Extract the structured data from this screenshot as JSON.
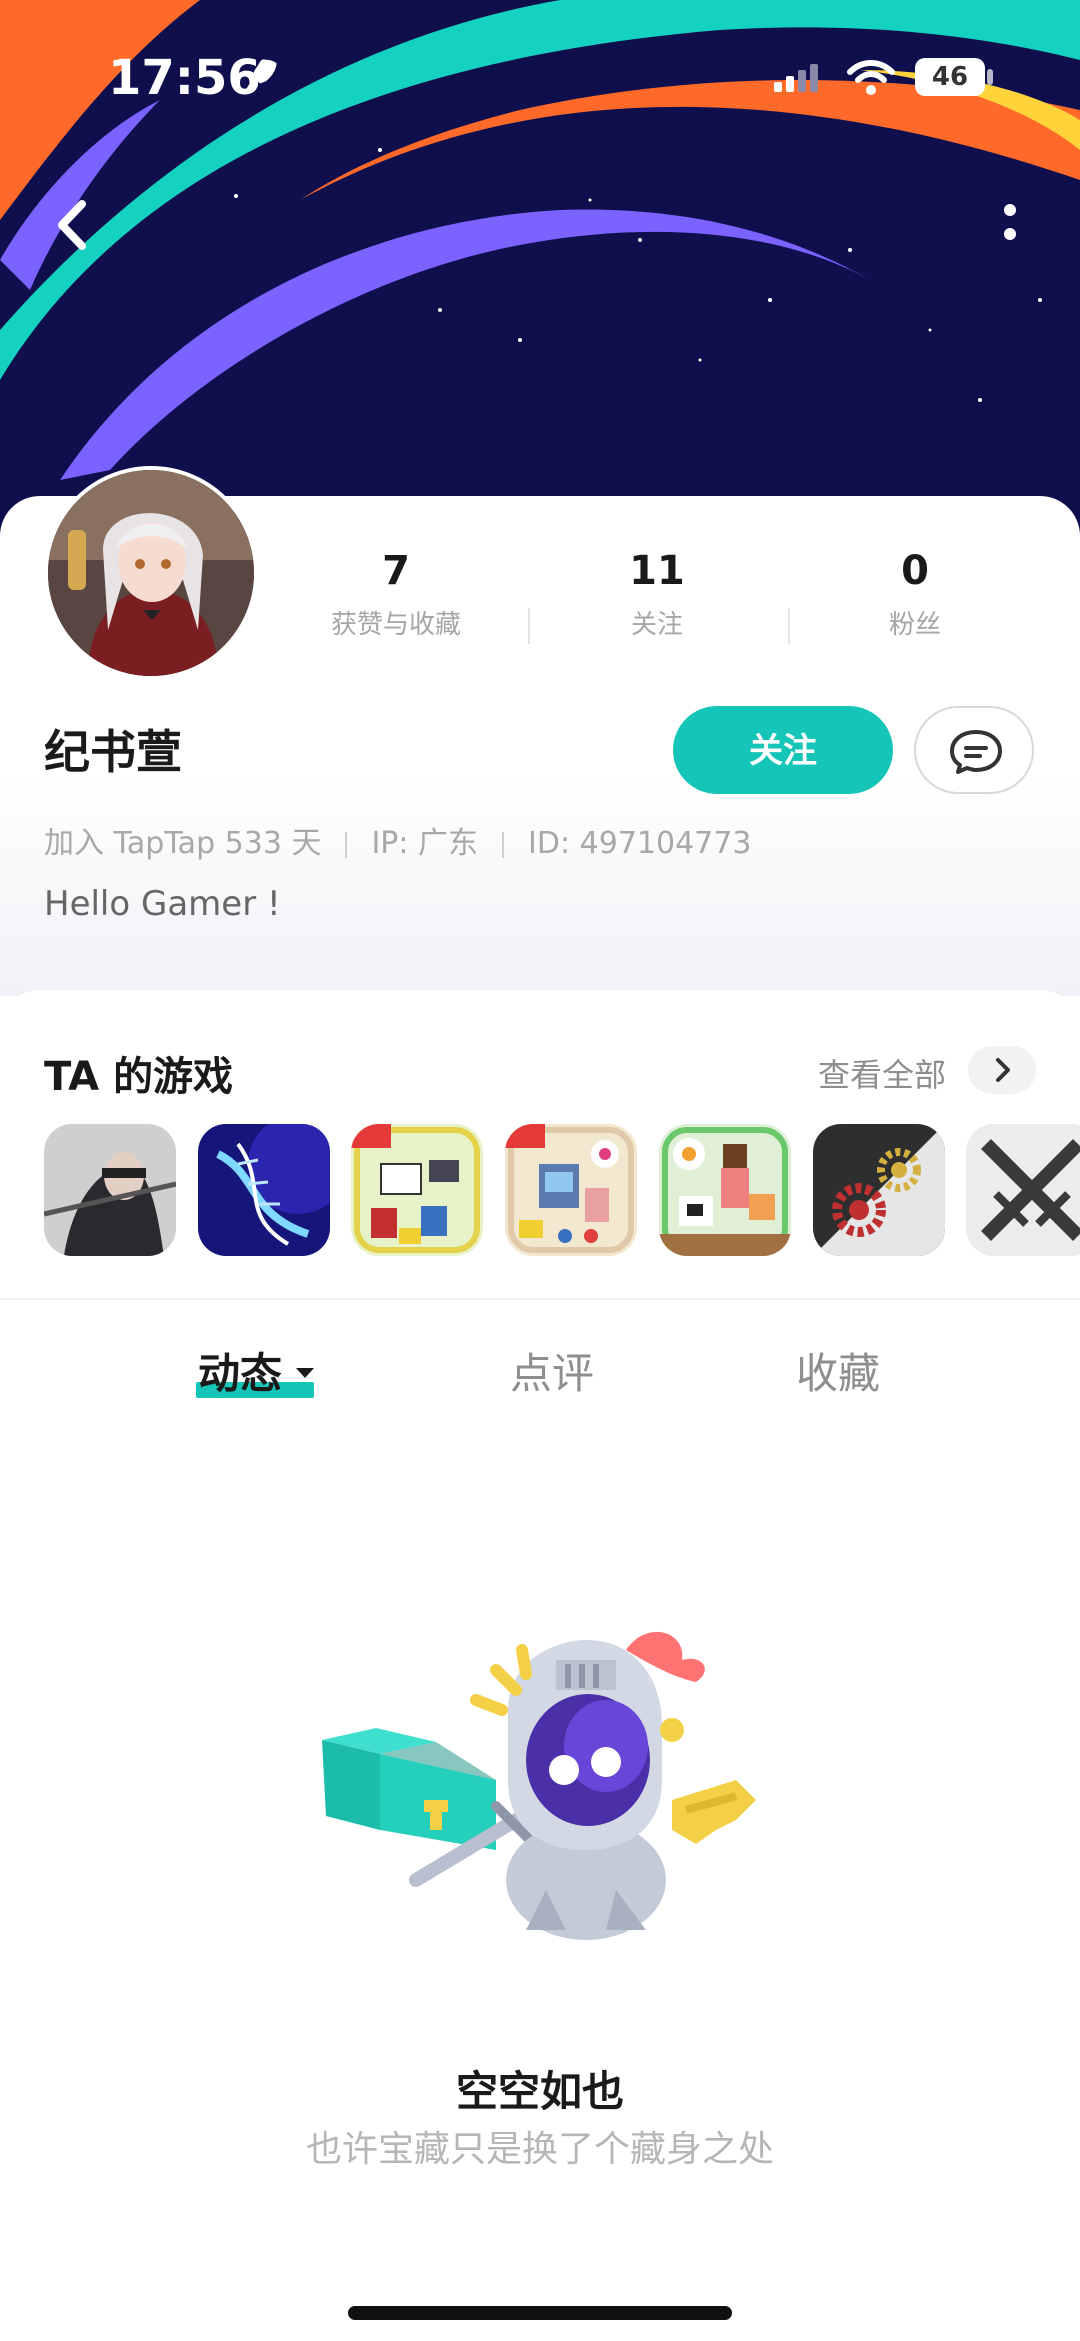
{
  "status_bar": {
    "time": "17:56",
    "battery": "46"
  },
  "header": {
    "back_icon": "chevron-left-icon",
    "more_icon": "more-vertical-icon"
  },
  "stats": [
    {
      "value": "7",
      "label": "获赞与收藏"
    },
    {
      "value": "11",
      "label": "关注"
    },
    {
      "value": "0",
      "label": "粉丝"
    }
  ],
  "profile": {
    "name": "纪书萱",
    "follow_label": "关注",
    "meta": [
      "加入 TapTap 533 天",
      "IP: 广东",
      "ID: 497104773"
    ],
    "bio": "Hello Gamer !"
  },
  "games": {
    "title": "TA 的游戏",
    "see_all": "查看全部",
    "items": [
      "game-1",
      "game-2",
      "game-3",
      "game-4",
      "game-5",
      "game-6",
      "game-7"
    ]
  },
  "tabs": [
    {
      "label": "动态",
      "active": true
    },
    {
      "label": "点评",
      "active": false
    },
    {
      "label": "收藏",
      "active": false
    }
  ],
  "empty_state": {
    "title": "空空如也",
    "subtitle": "也许宝藏只是换了个藏身之处"
  },
  "colors": {
    "accent": "#15c5b8",
    "header_bg": "#0f0f4e"
  }
}
